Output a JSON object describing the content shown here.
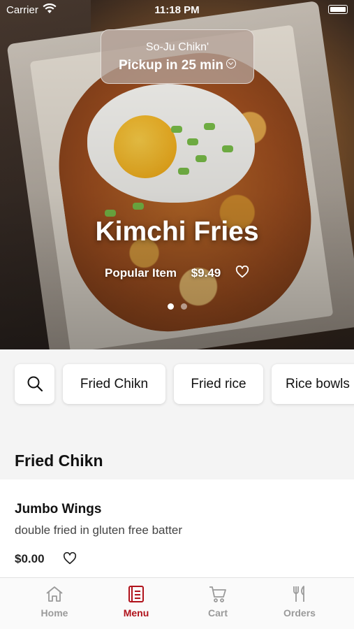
{
  "status_bar": {
    "carrier": "Carrier",
    "time": "11:18 PM"
  },
  "pickup": {
    "store_name": "So-Ju Chikn'",
    "eta_text": "Pickup in 25 min"
  },
  "hero": {
    "title": "Kimchi Fries",
    "tag": "Popular Item",
    "price": "$9.49",
    "carousel_pages": 2,
    "carousel_active_index": 0
  },
  "categories": [
    "Fried Chikn",
    "Fried rice",
    "Rice bowls"
  ],
  "section": {
    "title": "Fried Chikn"
  },
  "menu_item": {
    "name": "Jumbo Wings",
    "description": "double fried in gluten free batter",
    "price": "$0.00"
  },
  "tabs": [
    {
      "label": "Home",
      "icon": "home-icon",
      "active": false
    },
    {
      "label": "Menu",
      "icon": "menu-icon",
      "active": true
    },
    {
      "label": "Cart",
      "icon": "cart-icon",
      "active": false
    },
    {
      "label": "Orders",
      "icon": "fork-knife-icon",
      "active": false
    }
  ],
  "colors": {
    "accent": "#b0121b",
    "inactive_tab": "#9a9a9a"
  }
}
